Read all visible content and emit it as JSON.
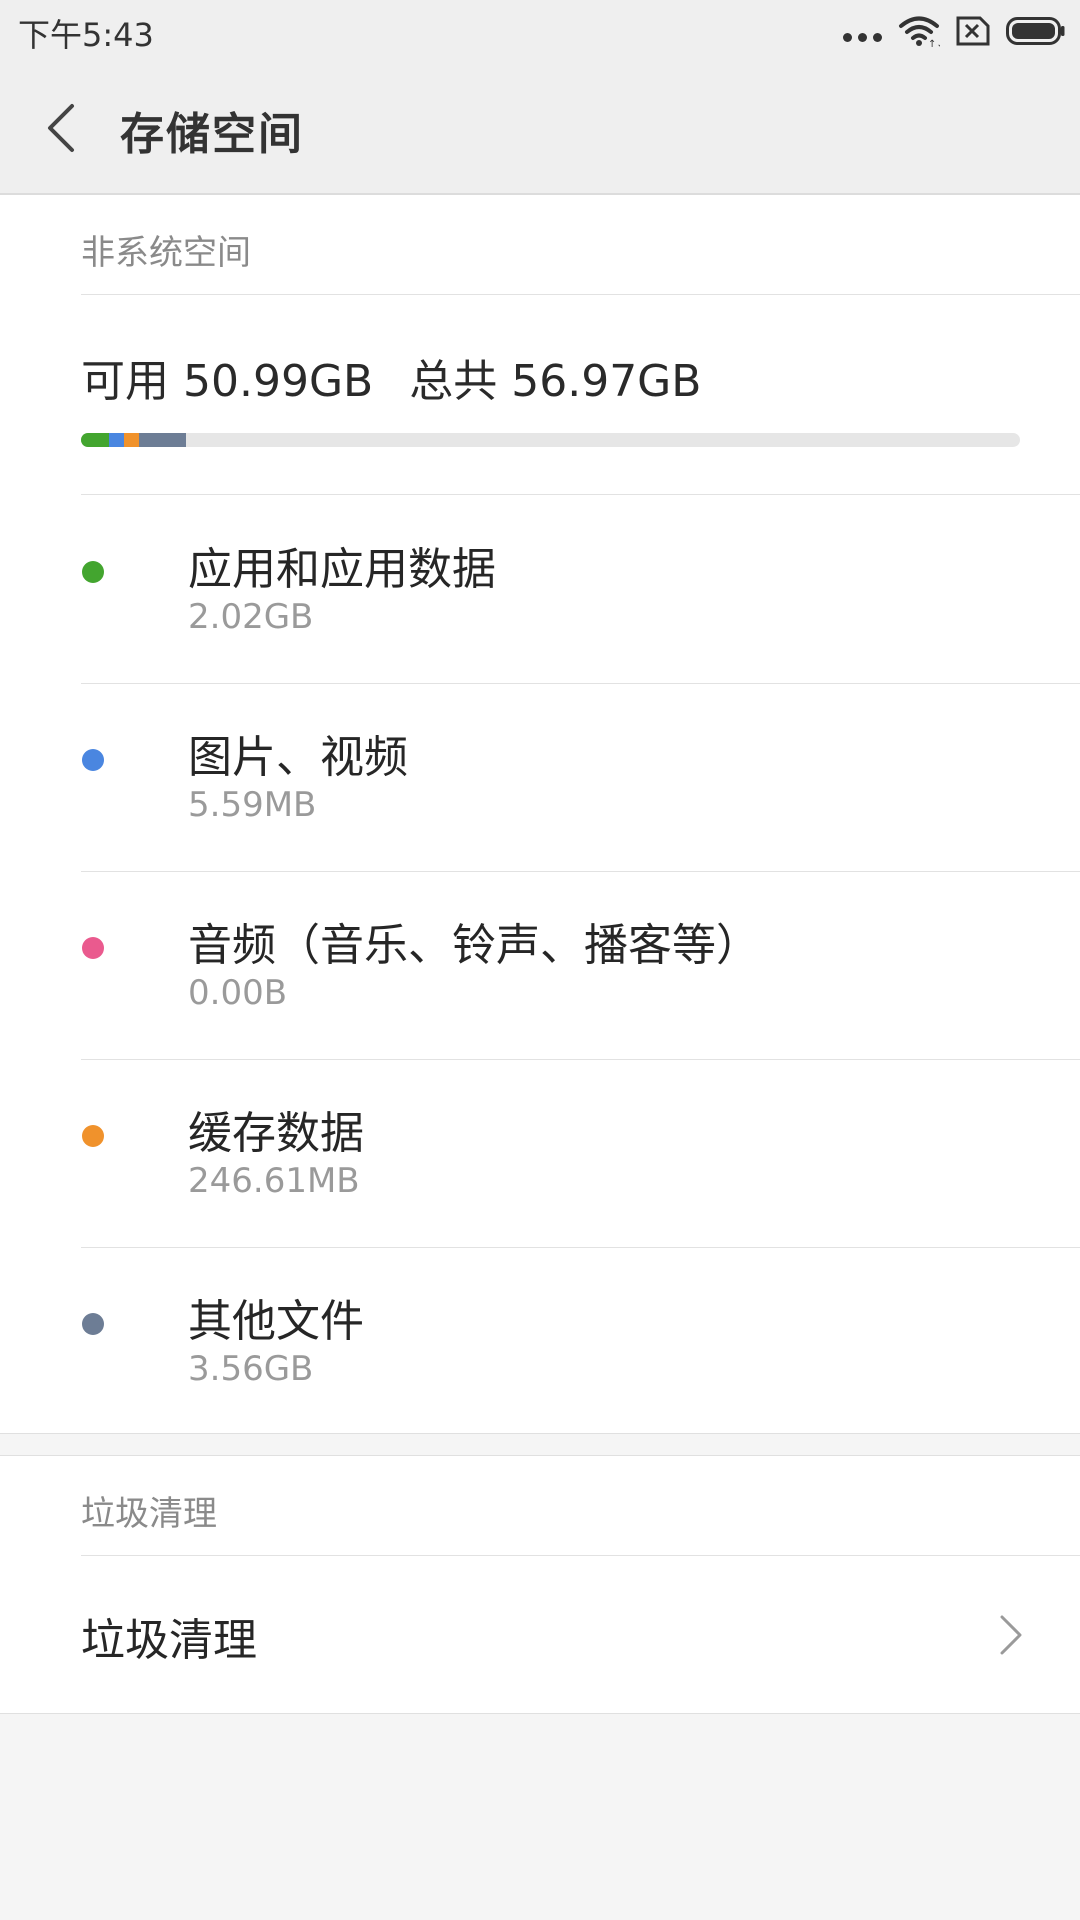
{
  "status_bar": {
    "time": "下午5:43",
    "icons": [
      "more-dots-icon",
      "wifi-icon",
      "no-sim-icon",
      "battery-icon"
    ]
  },
  "header": {
    "title": "存储空间",
    "back_icon": "back-arrow-icon"
  },
  "storage": {
    "section_title": "非系统空间",
    "available_label": "可用 50.99GB",
    "total_label": "总共 56.97GB",
    "usage_bar": [
      {
        "name": "应用和应用数据",
        "size_gb": 2.02,
        "color": "#43a52f"
      },
      {
        "name": "图片、视频",
        "size_gb": 0.00559,
        "color": "#4a86e0"
      },
      {
        "name": "音频（音乐、铃声、播客等）",
        "size_gb": 0.0,
        "color": "#ea5a8e"
      },
      {
        "name": "缓存数据",
        "size_gb": 0.24661,
        "color": "#f0922c"
      },
      {
        "name": "其他文件",
        "size_gb": 3.56,
        "color": "#6d7d95"
      }
    ],
    "usage_bar_display_fractions": [
      0.0295,
      0.0165,
      0,
      0.0155,
      0.05
    ],
    "items": [
      {
        "label": "应用和应用数据",
        "size": "2.02GB",
        "color": "#43a52f"
      },
      {
        "label": "图片、视频",
        "size": "5.59MB",
        "color": "#4a86e0"
      },
      {
        "label": "音频（音乐、铃声、播客等）",
        "size": "0.00B",
        "color": "#ea5a8e"
      },
      {
        "label": "缓存数据",
        "size": "246.61MB",
        "color": "#f0922c"
      },
      {
        "label": "其他文件",
        "size": "3.56GB",
        "color": "#6d7d95"
      }
    ]
  },
  "cleanup": {
    "section_title": "垃圾清理",
    "item_label": "垃圾清理",
    "chevron_icon": "chevron-right-icon"
  }
}
